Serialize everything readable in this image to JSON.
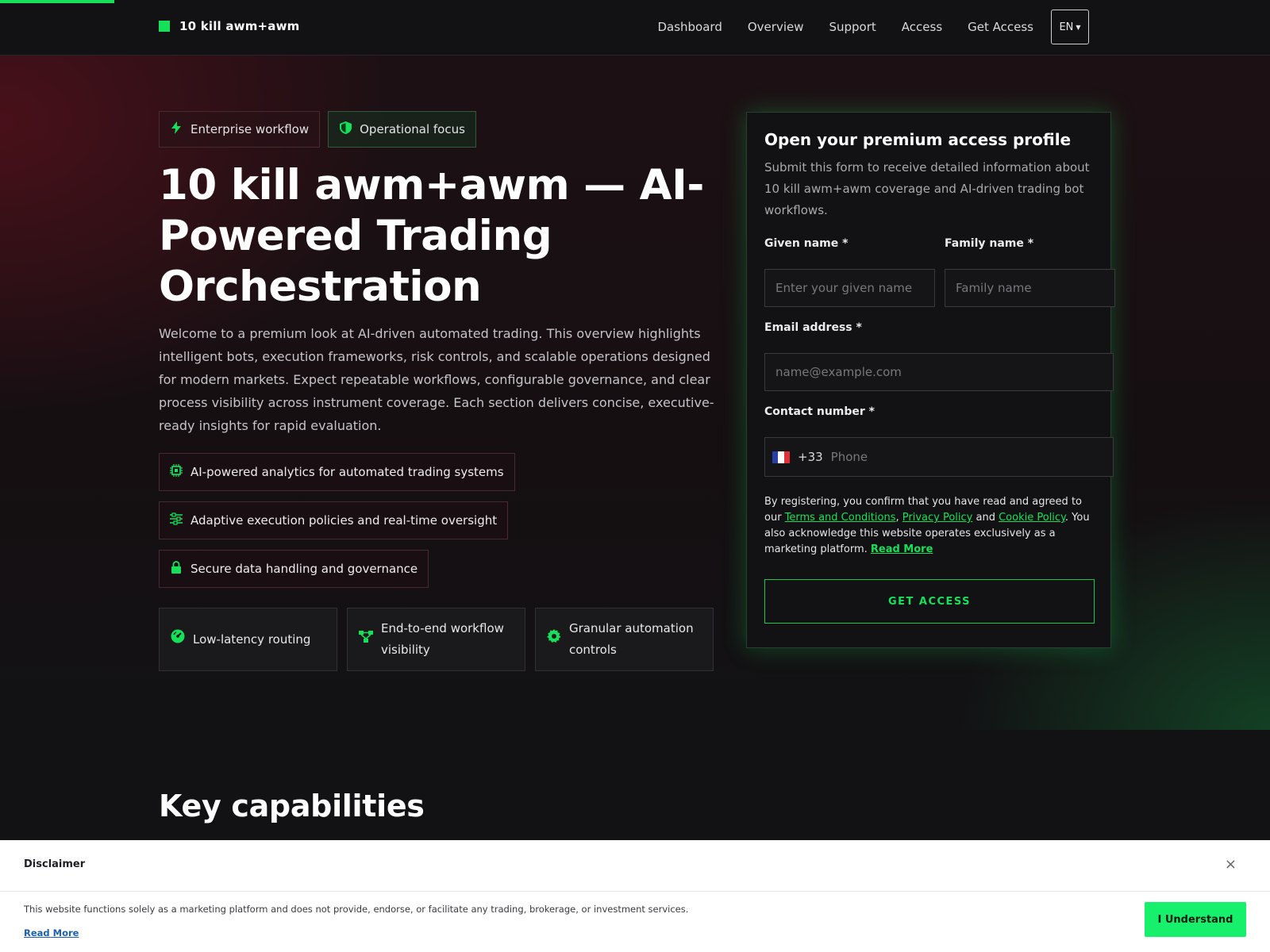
{
  "brand": {
    "name": "10 kill awm+awm",
    "accent": "#16e05a"
  },
  "nav": {
    "items": [
      "Dashboard",
      "Overview",
      "Support",
      "Access",
      "Get Access"
    ],
    "language": "EN"
  },
  "hero": {
    "chips": [
      {
        "label": "Enterprise workflow",
        "icon": "bolt-icon"
      },
      {
        "label": "Operational focus",
        "icon": "shield-icon"
      }
    ],
    "title": "10 kill awm+awm — AI-Powered Trading Orchestration",
    "intro": "Welcome to a premium look at AI-driven automated trading. This overview highlights intelligent bots, execution frameworks, risk controls, and scalable operations designed for modern markets. Expect repeatable workflows, configurable governance, and clear process visibility across instrument coverage. Each section delivers concise, executive-ready insights for rapid evaluation.",
    "features": [
      {
        "label": "AI-powered analytics for automated trading systems",
        "icon": "chip-icon"
      },
      {
        "label": "Adaptive execution policies and real-time oversight",
        "icon": "sliders-icon"
      },
      {
        "label": "Secure data handling and governance",
        "icon": "lock-icon"
      }
    ],
    "cards": [
      {
        "label": "Low-latency routing",
        "icon": "gauge-icon"
      },
      {
        "label": "End-to-end workflow visibility",
        "icon": "workflow-icon"
      },
      {
        "label": "Granular automation controls",
        "icon": "gear-icon"
      }
    ]
  },
  "form": {
    "title": "Open your premium access profile",
    "subtitle": "Submit this form to receive detailed information about 10 kill awm+awm coverage and AI-driven trading bot workflows.",
    "given_label": "Given name *",
    "given_placeholder": "Enter your given name",
    "family_label": "Family name *",
    "family_placeholder": "Family name",
    "email_label": "Email address *",
    "email_placeholder": "name@example.com",
    "phone_label": "Contact number *",
    "dial_code": "+33",
    "phone_placeholder": "Phone",
    "legal_pre": "By registering, you confirm that you have read and agreed to our ",
    "terms": "Terms and Conditions",
    "sep1": ", ",
    "privacy": "Privacy Policy",
    "sep2": " and ",
    "cookie": "Cookie Policy",
    "legal_post": ". You also acknowledge this website operates exclusively as a marketing platform. ",
    "read_more": "Read More",
    "submit": "GET ACCESS"
  },
  "section": {
    "title": "Key capabilities"
  },
  "disclaimer": {
    "title": "Disclaimer",
    "close": "×",
    "text": "This website functions solely as a marketing platform and does not provide, endorse, or facilitate any trading, brokerage, or investment services.",
    "read_more": "Read More",
    "button": "I Understand"
  }
}
